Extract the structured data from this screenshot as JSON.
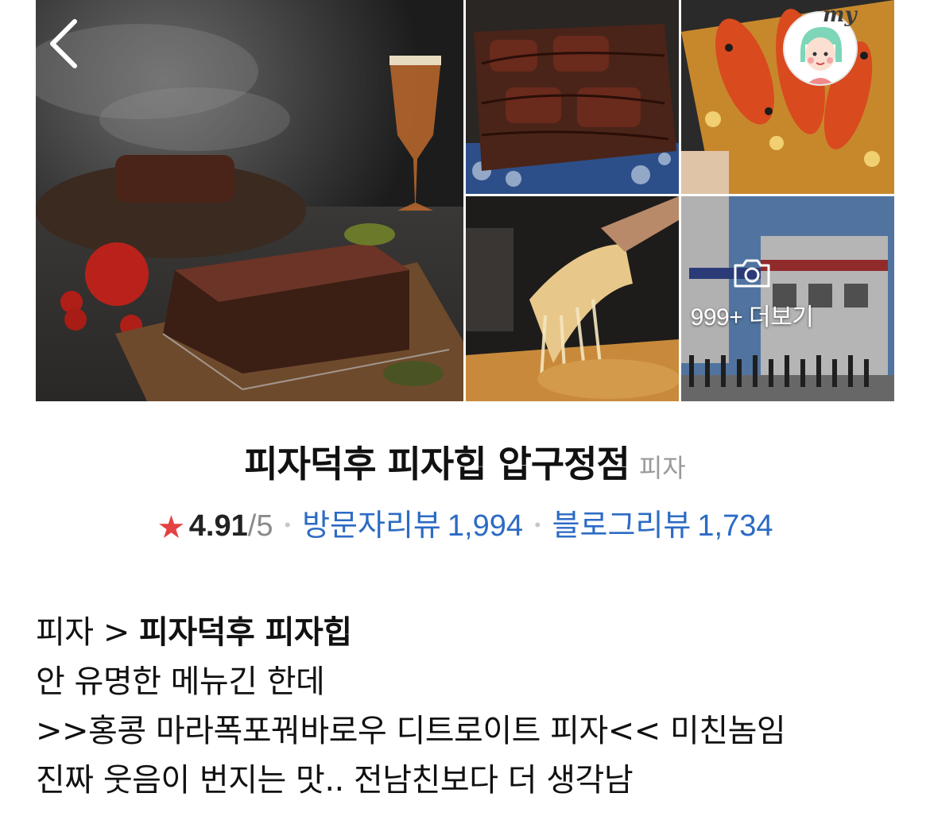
{
  "header": {
    "back_icon": "chevron-left-icon",
    "my_label": "my",
    "more_photos_label": "999+ 더보기",
    "camera_icon": "camera-icon"
  },
  "place": {
    "name": "피자덕후 피자힙 압구정점",
    "category": "피자",
    "rating": "4.91",
    "rating_max": "/5",
    "visitor_reviews_label": "방문자리뷰",
    "visitor_reviews_count": "1,994",
    "blog_reviews_label": "블로그리뷰",
    "blog_reviews_count": "1,734",
    "star_color": "#e34242",
    "link_color": "#2c6bc4"
  },
  "caption": {
    "line1_prefix": "피자 > ",
    "line1_bold": "피자덕후 피자힙",
    "line2": "안 유명한 메뉴긴 한데",
    "line3": ">>홍콩 마라폭포꿔바로우 디트로이트 피자<< 미친놈임",
    "line4": "진짜 웃음이 번지는 맛.. 전남친보다 더 생각남"
  }
}
